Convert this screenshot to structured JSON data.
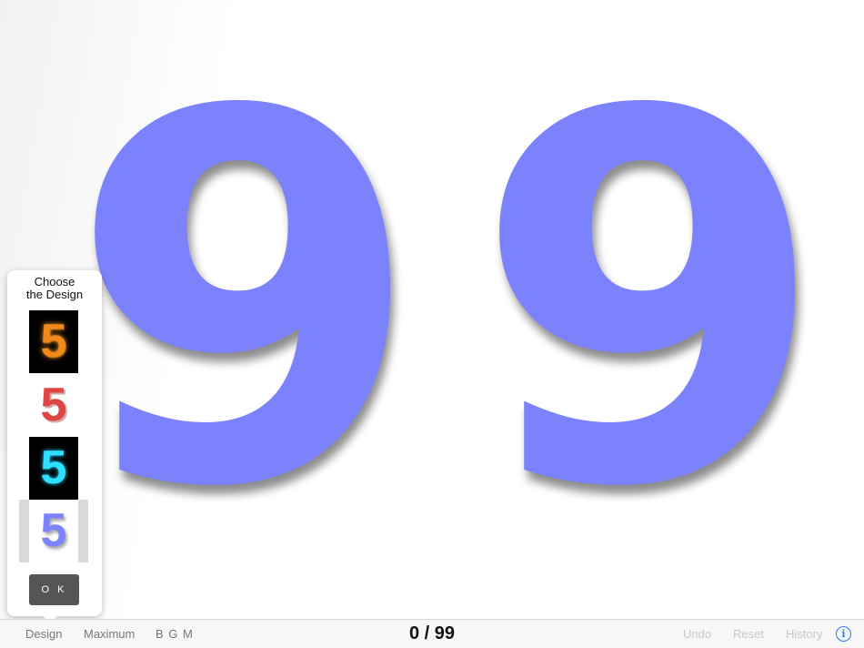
{
  "display": {
    "tens_digit": "9",
    "ones_digit": "9",
    "digit_color": "#7b82fb"
  },
  "design_popover": {
    "title": "Choose\nthe Design",
    "options": [
      {
        "glyph": "5",
        "style": "orange-glow-on-black"
      },
      {
        "glyph": "5",
        "style": "red-on-white"
      },
      {
        "glyph": "5",
        "style": "cyan-on-black"
      },
      {
        "glyph": "5",
        "style": "blue-on-white",
        "selected": true
      }
    ],
    "ok_label": "O K"
  },
  "toolbar": {
    "design_label": "Design",
    "maximum_label": "Maximum",
    "bgm_label": "B G M",
    "counter": "0 / 99",
    "undo_label": "Undo",
    "reset_label": "Reset",
    "history_label": "History",
    "info_icon": "info-circle-icon",
    "accent_color": "#2a7cf6"
  }
}
